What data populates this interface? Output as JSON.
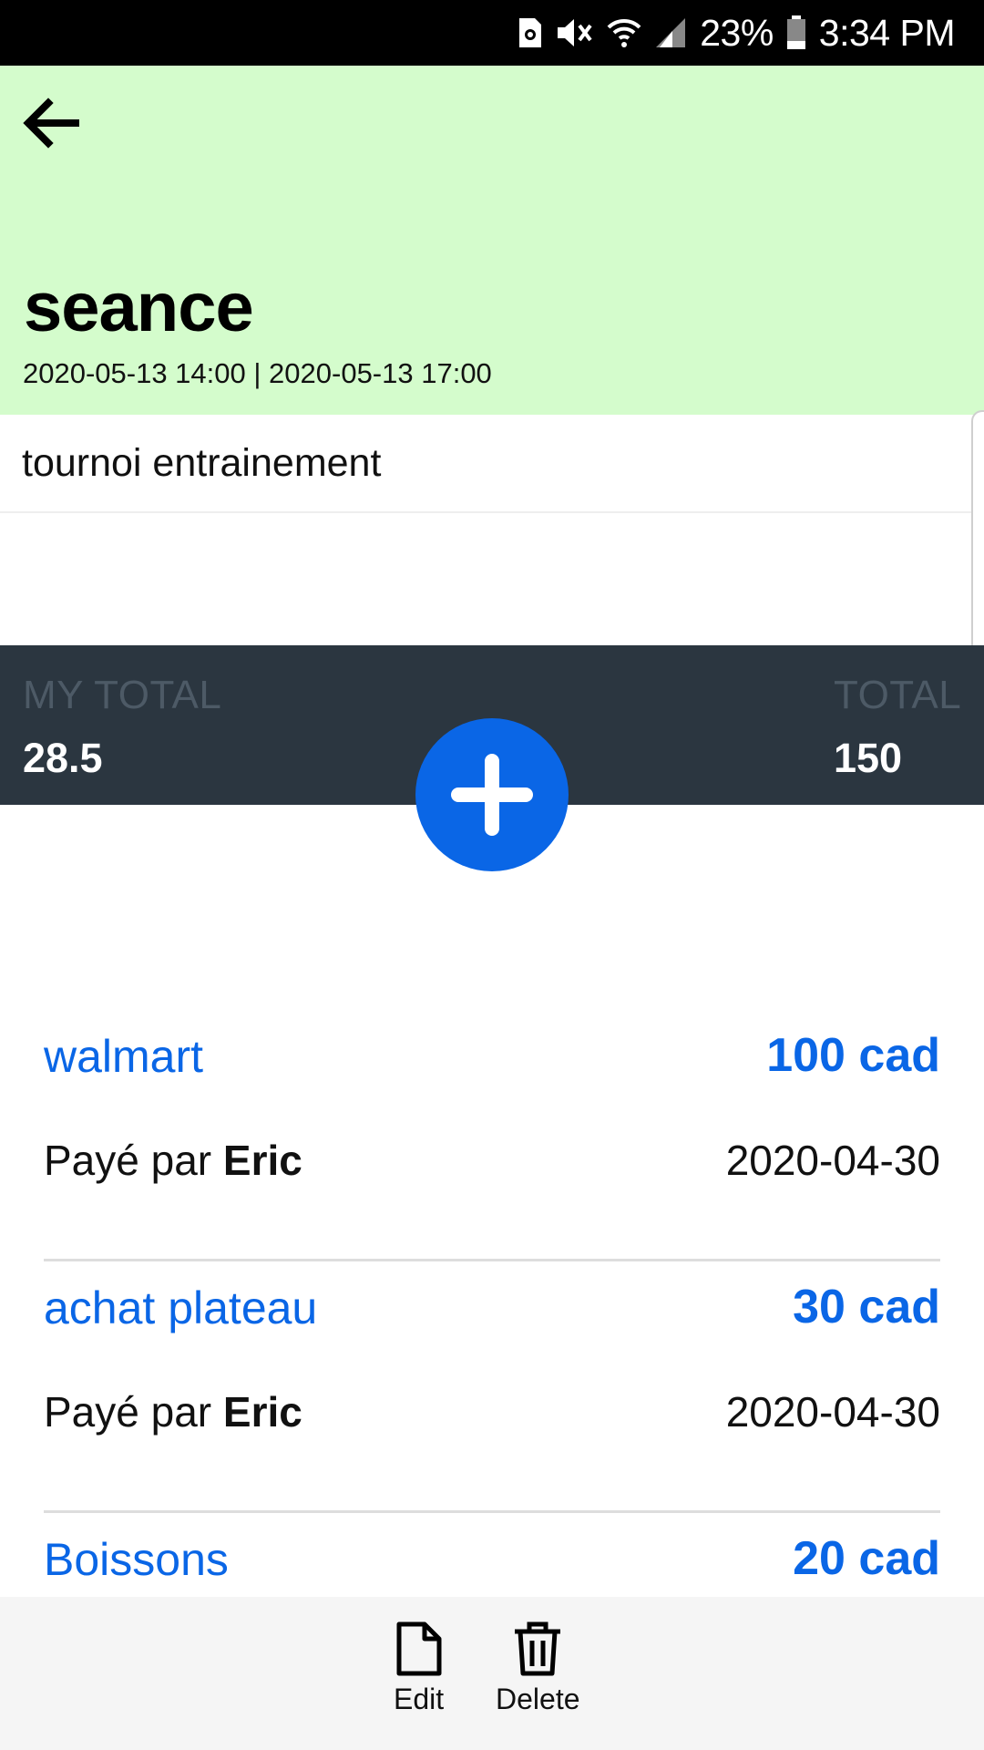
{
  "status_bar": {
    "battery_percent": "23%",
    "time": "3:34 PM",
    "icons": [
      "sim-icon",
      "mute-icon",
      "wifi-icon",
      "signal-icon",
      "battery-icon"
    ]
  },
  "header": {
    "title": "seance",
    "dates": "2020-05-13 14:00 | 2020-05-13 17:00",
    "background": "#d4fccc"
  },
  "description": "tournoi entrainement",
  "totals": {
    "my_total_label": "MY TOTAL",
    "my_total_value": "28.5",
    "total_label": "TOTAL",
    "total_value": "150"
  },
  "expenses": [
    {
      "name": "walmart",
      "amount": "100 cad",
      "payer_prefix": "Payé par",
      "payer": "Eric",
      "date": "2020-04-30"
    },
    {
      "name": "achat plateau",
      "amount": "30 cad",
      "payer_prefix": "Payé par",
      "payer": "Eric",
      "date": "2020-04-30"
    },
    {
      "name": "Boissons",
      "amount": "20 cad",
      "payer_prefix": "",
      "payer": "",
      "date": ""
    }
  ],
  "actions": {
    "edit_label": "Edit",
    "delete_label": "Delete"
  },
  "colors": {
    "accent": "#0a66e6",
    "totals_bar": "#2b3640",
    "header": "#d4fccc"
  }
}
